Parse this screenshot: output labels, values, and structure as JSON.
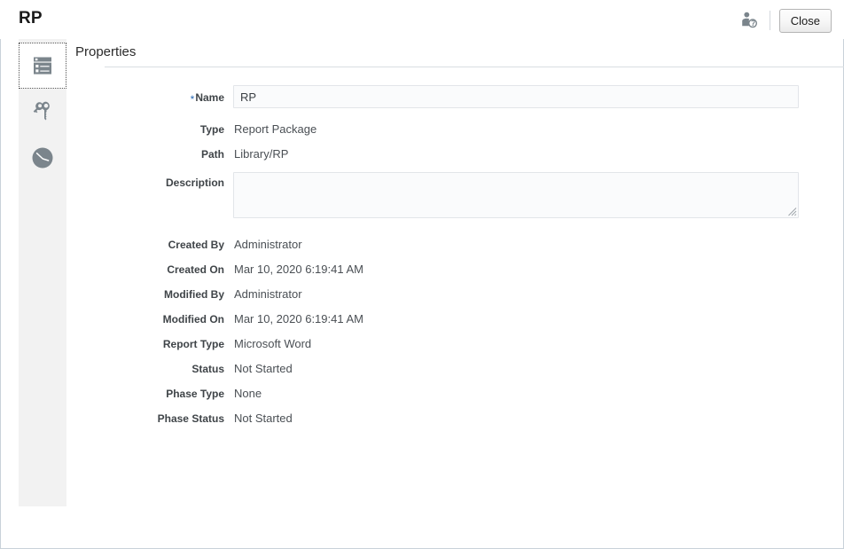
{
  "header": {
    "title": "RP",
    "user_icon_name": "user-restricted-icon",
    "close_label": "Close"
  },
  "sidebar": {
    "items": [
      {
        "name": "properties",
        "icon": "properties-list-icon",
        "selected": true
      },
      {
        "name": "access",
        "icon": "keys-icon",
        "selected": false
      },
      {
        "name": "history",
        "icon": "clock-icon",
        "selected": false
      }
    ]
  },
  "content": {
    "title": "Properties",
    "fields": {
      "name": {
        "label": "Name",
        "required_marker": "*",
        "value": "RP",
        "placeholder": ""
      },
      "type": {
        "label": "Type",
        "value": "Report Package"
      },
      "path": {
        "label": "Path",
        "value": "Library/RP"
      },
      "description": {
        "label": "Description",
        "value": "",
        "placeholder": ""
      },
      "created_by": {
        "label": "Created By",
        "value": "Administrator"
      },
      "created_on": {
        "label": "Created On",
        "value": "Mar 10, 2020 6:19:41 AM"
      },
      "modified_by": {
        "label": "Modified By",
        "value": "Administrator"
      },
      "modified_on": {
        "label": "Modified On",
        "value": "Mar 10, 2020 6:19:41 AM"
      },
      "report_type": {
        "label": "Report Type",
        "value": "Microsoft Word"
      },
      "status": {
        "label": "Status",
        "value": "Not Started"
      },
      "phase_type": {
        "label": "Phase Type",
        "value": "None"
      },
      "phase_status": {
        "label": "Phase Status",
        "value": "Not Started"
      }
    }
  },
  "colors": {
    "accent_required": "#2a6ab5",
    "sidebar_bg": "#f2f2f2",
    "icon_gray": "#7b858c",
    "frame_border": "#c9d2d9",
    "label_text": "#3f4448"
  }
}
